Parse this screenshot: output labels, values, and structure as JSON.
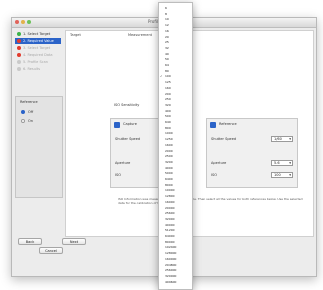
{
  "window": {
    "title": "Profile Assistant"
  },
  "steps": [
    {
      "label": "1. Select Target",
      "state": "done"
    },
    {
      "label": "2. Required Value",
      "state": "current"
    },
    {
      "label": "3. Select Target",
      "state": "pending"
    },
    {
      "label": "4. Required Data",
      "state": "pending"
    },
    {
      "label": "5. Profile Scan",
      "state": "pending"
    },
    {
      "label": "6. Results",
      "state": "pending"
    }
  ],
  "left_panel": {
    "title": "Reference",
    "options": [
      {
        "label": "Off",
        "selected": true
      },
      {
        "label": "On",
        "selected": false
      }
    ]
  },
  "main_headers": {
    "col1": "Target",
    "col2": "Measurement"
  },
  "iso_label": "ISO Sensitivity",
  "groups": [
    {
      "title": "Capture",
      "shutter_label": "Shutter Speed",
      "shutter_value": "",
      "aperture_label": "Aperture",
      "aperture_value": "",
      "iso_label": "ISO",
      "iso_value": ""
    },
    {
      "title": "Reference",
      "shutter_label": "Shutter Speed",
      "shutter_value": "1/60",
      "aperture_label": "Aperture",
      "aperture_value": "5.6",
      "iso_label": "ISO",
      "iso_value": "100"
    }
  ],
  "footnote": "ISO Information was measured from each target file. Then select all the values for both references below. Use the selected data for the calibration of the profile accordingly.",
  "buttons": {
    "back": "Back",
    "next": "Next",
    "cancel": "Cancel"
  },
  "iso_menu": {
    "selected": "100",
    "options": [
      "6",
      "8",
      "10",
      "12",
      "16",
      "20",
      "25",
      "32",
      "40",
      "50",
      "64",
      "80",
      "100",
      "125",
      "160",
      "200",
      "250",
      "320",
      "400",
      "500",
      "640",
      "800",
      "1000",
      "1250",
      "1600",
      "2000",
      "2500",
      "3200",
      "4000",
      "5000",
      "6400",
      "8000",
      "10000",
      "12800",
      "16000",
      "20000",
      "25600",
      "32000",
      "40000",
      "51200",
      "64000",
      "80000",
      "102400",
      "128000",
      "160000",
      "204800",
      "256000",
      "320000",
      "409600"
    ]
  },
  "colors": {
    "accent": "#2b63c8",
    "done": "#3cb34a",
    "alert": "#e23b2d"
  }
}
